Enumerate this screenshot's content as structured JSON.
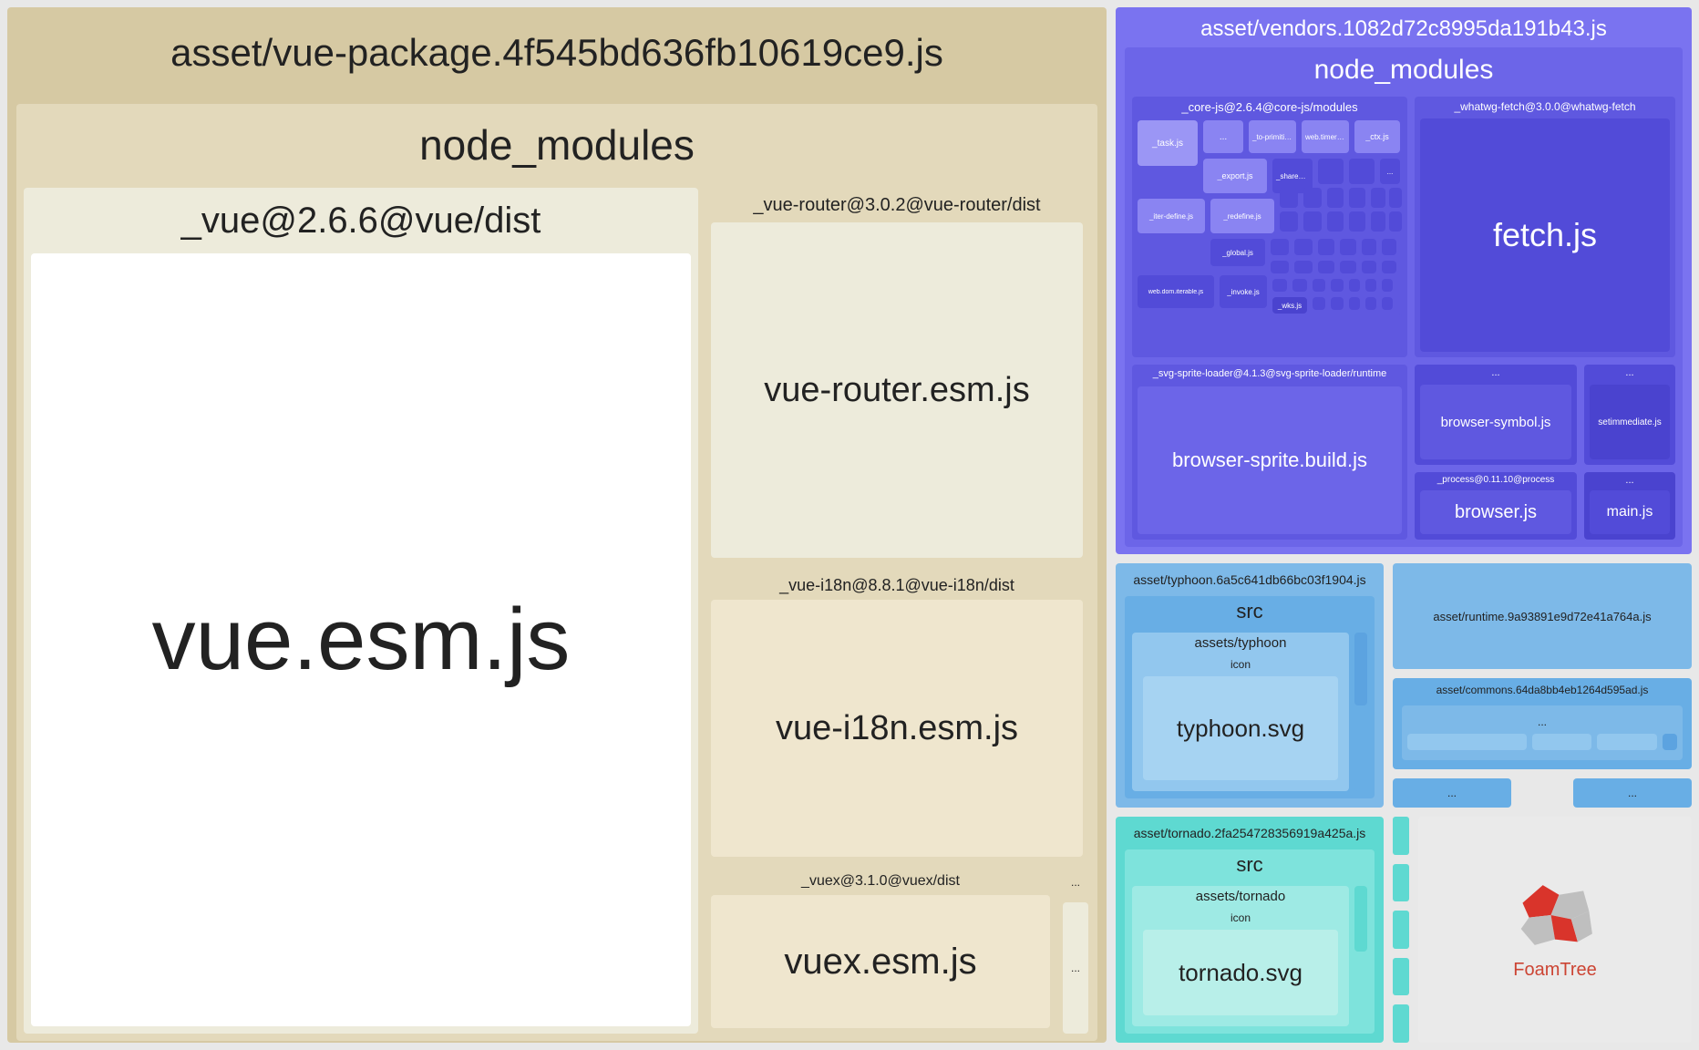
{
  "chart_data": {
    "type": "treemap",
    "tool": "FoamTree",
    "description": "Webpack bundle analyzer treemap showing relative sizes of JS asset chunks and their constituent modules.",
    "nodes": [
      {
        "name": "asset/vue-package.4f545bd636fb10619ce9.js",
        "color": "#d6c9a3",
        "children": [
          {
            "name": "node_modules",
            "children": [
              {
                "name": "_vue@2.6.6@vue/dist",
                "children": [
                  {
                    "name": "vue.esm.js"
                  }
                ]
              },
              {
                "name": "_vue-router@3.0.2@vue-router/dist",
                "children": [
                  {
                    "name": "vue-router.esm.js"
                  }
                ]
              },
              {
                "name": "_vue-i18n@8.8.1@vue-i18n/dist",
                "children": [
                  {
                    "name": "vue-i18n.esm.js"
                  }
                ]
              },
              {
                "name": "_vuex@3.1.0@vuex/dist",
                "children": [
                  {
                    "name": "vuex.esm.js"
                  }
                ]
              },
              {
                "name": "..."
              }
            ]
          }
        ]
      },
      {
        "name": "asset/vendors.1082d72c8995da191b43.js",
        "color": "#7a73f0",
        "children": [
          {
            "name": "node_modules",
            "children": [
              {
                "name": "_core-js@2.6.4@core-js/modules",
                "children": [
                  {
                    "name": "_task.js"
                  },
                  {
                    "name": "..."
                  },
                  {
                    "name": "_to-primitive.js"
                  },
                  {
                    "name": "web.timers.js"
                  },
                  {
                    "name": "_ctx.js"
                  },
                  {
                    "name": "_export.js"
                  },
                  {
                    "name": "_shared.js"
                  },
                  {
                    "name": "_iter-define.js"
                  },
                  {
                    "name": "_redefine.js"
                  },
                  {
                    "name": "_global.js"
                  },
                  {
                    "name": "web.dom.iterable.js"
                  },
                  {
                    "name": "_invoke.js"
                  },
                  {
                    "name": "_wks.js"
                  }
                ]
              },
              {
                "name": "_whatwg-fetch@3.0.0@whatwg-fetch",
                "children": [
                  {
                    "name": "fetch.js"
                  }
                ]
              },
              {
                "name": "_svg-sprite-loader@4.1.3@svg-sprite-loader/runtime",
                "children": [
                  {
                    "name": "browser-sprite.build.js"
                  }
                ]
              },
              {
                "name": "...",
                "children": [
                  {
                    "name": "browser-symbol.js"
                  }
                ]
              },
              {
                "name": "...",
                "children": [
                  {
                    "name": "setimmediate.js"
                  }
                ]
              },
              {
                "name": "_process@0.11.10@process",
                "children": [
                  {
                    "name": "browser.js"
                  }
                ]
              },
              {
                "name": "...",
                "children": [
                  {
                    "name": "main.js"
                  }
                ]
              }
            ]
          }
        ]
      },
      {
        "name": "asset/typhoon.6a5c641db66bc03f1904.js",
        "color": "#7db9e8",
        "children": [
          {
            "name": "src",
            "children": [
              {
                "name": "assets/typhoon",
                "children": [
                  {
                    "name": "icon",
                    "children": [
                      {
                        "name": "typhoon.svg"
                      }
                    ]
                  }
                ]
              }
            ]
          }
        ]
      },
      {
        "name": "asset/tornado.2fa254728356919a425a.js",
        "color": "#5ed9d1",
        "children": [
          {
            "name": "src",
            "children": [
              {
                "name": "assets/tornado",
                "children": [
                  {
                    "name": "icon",
                    "children": [
                      {
                        "name": "tornado.svg"
                      }
                    ]
                  }
                ]
              }
            ]
          }
        ]
      },
      {
        "name": "asset/runtime.9a93891e9d72e41a764a.js",
        "color": "#7db9e8"
      },
      {
        "name": "asset/commons.64da8bb4eb1264d595ad.js",
        "color": "#68aee5",
        "children": [
          {
            "name": "..."
          }
        ]
      },
      {
        "name": "...",
        "color": "#68aee5"
      },
      {
        "name": "...",
        "color": "#68aee5"
      }
    ]
  },
  "vue_package": {
    "title": "asset/vue-package.4f545bd636fb10619ce9.js",
    "node_modules": "node_modules",
    "vue_dist": "_vue@2.6.6@vue/dist",
    "vue_esm": "vue.esm.js",
    "router_dist": "_vue-router@3.0.2@vue-router/dist",
    "router_esm": "vue-router.esm.js",
    "i18n_dist": "_vue-i18n@8.8.1@vue-i18n/dist",
    "i18n_esm": "vue-i18n.esm.js",
    "vuex_dist": "_vuex@3.1.0@vuex/dist",
    "vuex_esm": "vuex.esm.js",
    "dots": "..."
  },
  "vendors": {
    "title": "asset/vendors.1082d72c8995da191b43.js",
    "node_modules": "node_modules",
    "corejs": "_core-js@2.6.4@core-js/modules",
    "task": "_task.js",
    "export": "_export.js",
    "iter": "_iter-define.js",
    "redefine": "_redefine.js",
    "webdom": "web.dom.iterable.js",
    "invoke": "_invoke.js",
    "wks": "_wks.js",
    "global": "_global.js",
    "shared": "_shared.js",
    "toprim": "_to-primitive.js",
    "webtimers": "web.timers.js",
    "ctx": "_ctx.js",
    "dots": "...",
    "whatwg": "_whatwg-fetch@3.0.0@whatwg-fetch",
    "fetch": "fetch.js",
    "svgsprite": "_svg-sprite-loader@4.1.3@svg-sprite-loader/runtime",
    "browsersprite": "browser-sprite.build.js",
    "browsersymbol": "browser-symbol.js",
    "setimmediate": "setimmediate.js",
    "process": "_process@0.11.10@process",
    "browser": "browser.js",
    "main": "main.js"
  },
  "typhoon": {
    "title": "asset/typhoon.6a5c641db66bc03f1904.js",
    "src": "src",
    "assets": "assets/typhoon",
    "icon": "icon",
    "svg": "typhoon.svg"
  },
  "tornado": {
    "title": "asset/tornado.2fa254728356919a425a.js",
    "src": "src",
    "assets": "assets/tornado",
    "icon": "icon",
    "svg": "tornado.svg"
  },
  "runtime": {
    "title": "asset/runtime.9a93891e9d72e41a764a.js"
  },
  "commons": {
    "title": "asset/commons.64da8bb4eb1264d595ad.js",
    "dots": "..."
  },
  "tiny1": "...",
  "tiny2": "...",
  "brand": "FoamTree"
}
